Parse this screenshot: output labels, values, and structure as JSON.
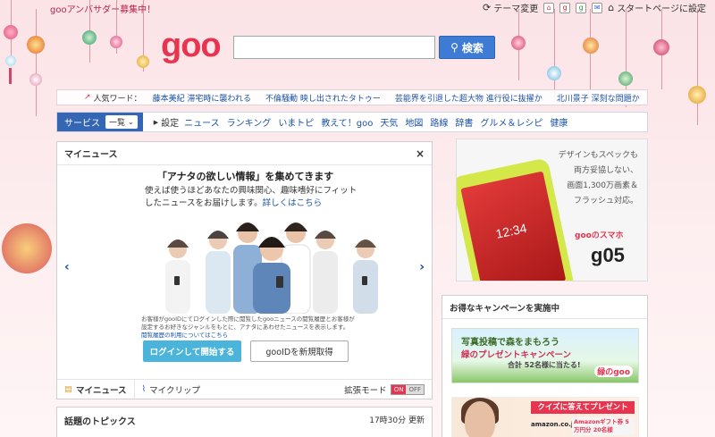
{
  "topbar": {
    "ambassador": "gooアンバサダー募集中！",
    "theme_change": "テーマ変更",
    "set_home": "スタートページに設定"
  },
  "logo": "goo",
  "search": {
    "value": "",
    "placeholder": "",
    "button_label": "検索"
  },
  "popular": {
    "label": "人気ワード：",
    "words": [
      "藤本美紀 滞宅時に襲われる",
      "不倫騒動 映し出されたタトゥー",
      "芸能界を引退した超大物 進行役に抜擢か",
      "北川景子 深刻な問題か"
    ]
  },
  "service_bar": {
    "label": "サービス",
    "select": "一覧",
    "setting": "設定",
    "links": [
      "ニュース",
      "ランキング",
      "いまトピ",
      "教えて！goo",
      "天気",
      "地図",
      "路線",
      "辞書",
      "グルメ＆レシピ",
      "健康"
    ]
  },
  "mynews": {
    "title": "マイニュース",
    "close": "×",
    "heading": "「アナタの欲しい情報」を集めてきます",
    "sub": "使えば使うほどあなたの興味関心、趣味嗜好にフィットしたニュースをお届けします。",
    "detail_link": "詳しくはこちら",
    "note": "お客様がgooIDにてログインした際に閲覧したgooニュースの閲覧履歴とお客様が設定するお好きなジャンルをもとに、アナタにあわせたニュースを表示します。",
    "history_link": "閲覧履歴の利用についてはこちら",
    "login_button": "ログインして開始する",
    "register_button": "gooIDを新規取得",
    "tab_mynews": "マイニュース",
    "tab_myclip": "マイクリップ",
    "extended_mode": "拡張モード",
    "toggle_on": "ON",
    "toggle_off": "OFF",
    "prev_arrow": "‹",
    "next_arrow": "›"
  },
  "topics": {
    "title": "話題のトピックス",
    "time": "17時30分 更新"
  },
  "ad_phone": {
    "copy_lines": [
      "デザインもスペックも",
      "両方妥協しない、",
      "画面1,300万画素＆",
      "フラッシュ対応。"
    ],
    "brand": "gooのスマホ",
    "model": "g05",
    "screen_time": "12:34"
  },
  "campaign": {
    "title": "お得なキャンペーンを実施中",
    "banner1_line1": "写真投稿で森をまもろう",
    "banner1_line2": "緑のプレゼントキャンペーン",
    "banner1_line3": "合計 52名様に当たる!",
    "banner1_logo": "緑のgoo",
    "banner2_head": "クイズに答えてプレゼント",
    "banner2_amazon": "amazon.co.jp",
    "banner2_gift": "Amazonギフト券 5万円分 20名様"
  },
  "colors": {
    "brand": "#e8344e",
    "link": "#1a53a6",
    "service_blue": "#3566b4",
    "search_button": "#3d7bd4",
    "login_button": "#4bb4da"
  }
}
